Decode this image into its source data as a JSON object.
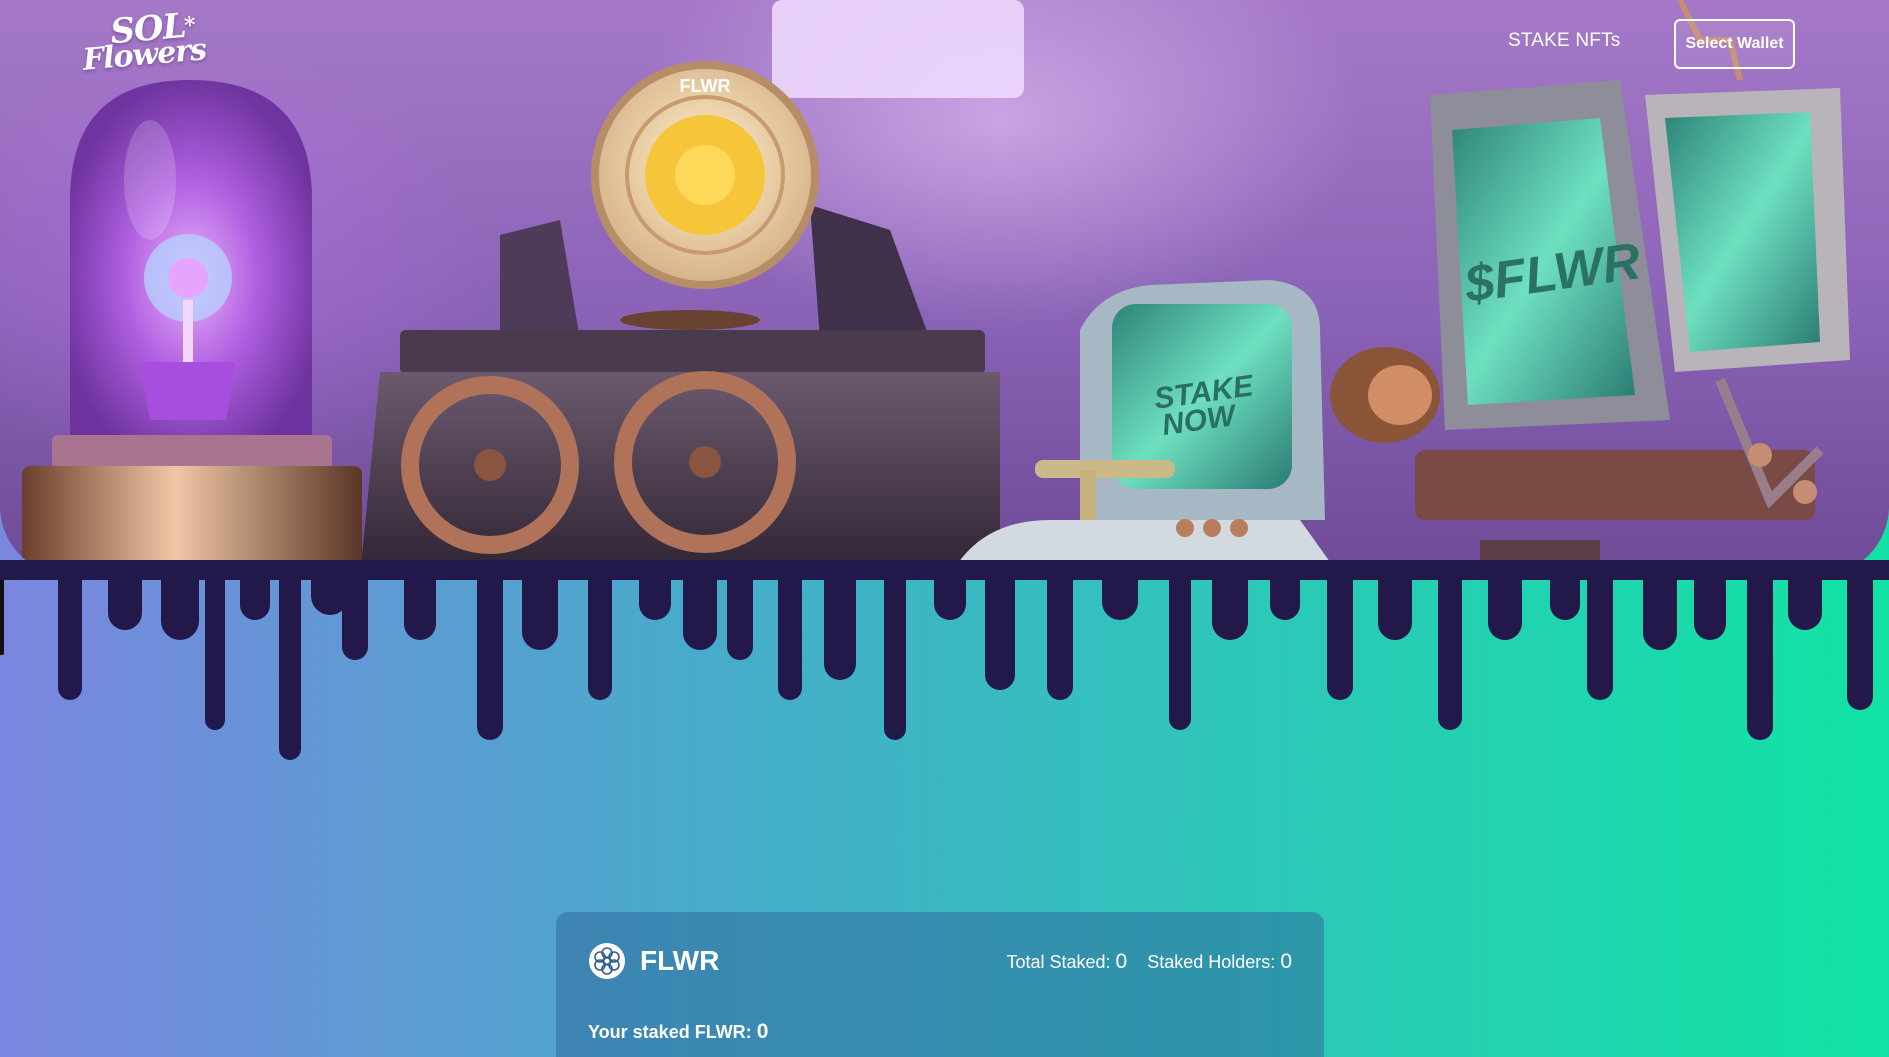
{
  "nav": {
    "logo_line1": "SOL",
    "logo_line2": "Flowers",
    "stake_link": "STAKE NFTs",
    "wallet_button": "Select Wallet"
  },
  "hero": {
    "coin_text": "FLWR",
    "monitor_text": "$FLWR",
    "terminal_line1": "STAKE",
    "terminal_line2": "NOW"
  },
  "card": {
    "token_name": "FLWR",
    "total_staked_label": "Total Staked:",
    "total_staked_value": "0",
    "holders_label": "Staked Holders:",
    "holders_value": "0",
    "your_staked_label": "Your staked FLWR:",
    "your_staked_value": "0"
  },
  "colors": {
    "drip": "#23184a",
    "gradient_left": "#7a86df",
    "gradient_right": "#12e3a4",
    "screen_green": "#5fd8b3"
  }
}
